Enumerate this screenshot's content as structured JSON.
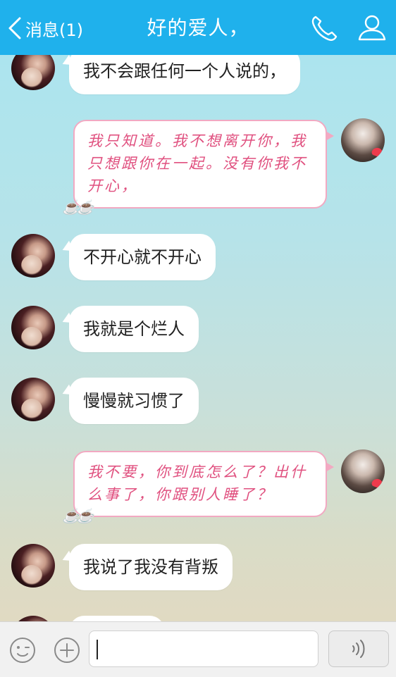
{
  "header": {
    "back_label": "消息(1)",
    "title": "好的爱人，"
  },
  "messages": [
    {
      "side": "left",
      "text": "我不会跟任何一个人说的，"
    },
    {
      "side": "right",
      "lines": [
        "我只知道。我不想离开你，我",
        "只想跟你在一起。没有你我不",
        "开心，"
      ]
    },
    {
      "side": "left",
      "text": "不开心就不开心"
    },
    {
      "side": "left",
      "text": "我就是个烂人"
    },
    {
      "side": "left",
      "text": "慢慢就习惯了"
    },
    {
      "side": "right",
      "lines": [
        "我不要，你到底怎么了？出什",
        "么事了，你跟别人睡了？"
      ]
    },
    {
      "side": "left",
      "text": "我说了我没有背叛"
    }
  ],
  "colors": {
    "header": "#1fb1ec",
    "pink_text": "#e0507f",
    "pink_border": "#f2a9c2"
  },
  "icons": [
    "back-arrow-icon",
    "phone-icon",
    "contact-icon",
    "emoji-icon",
    "plus-icon",
    "voice-icon"
  ]
}
